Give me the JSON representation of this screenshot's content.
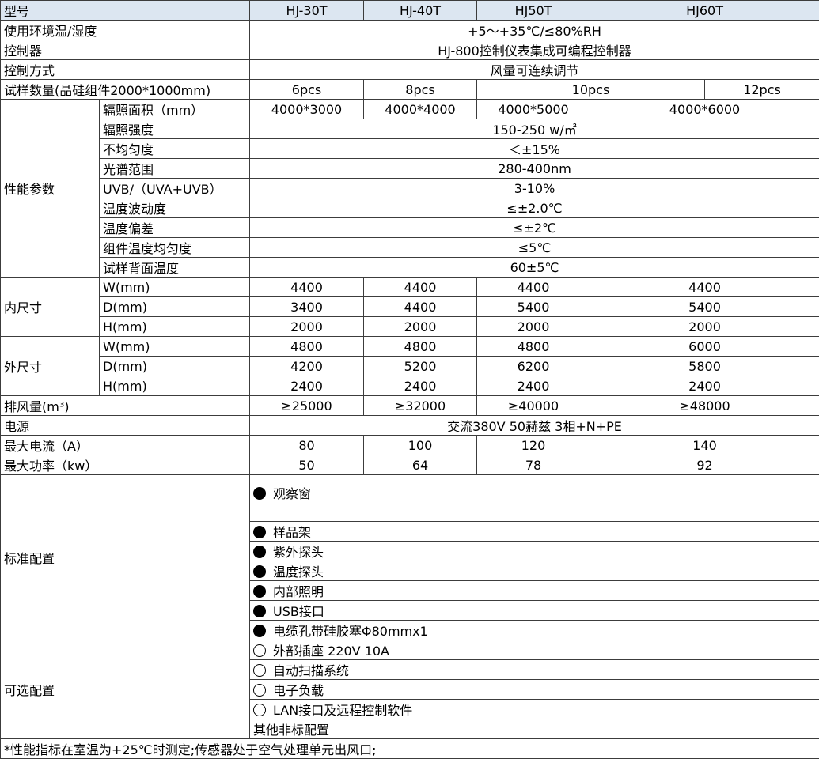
{
  "header": {
    "model": "型号",
    "m1": "HJ-30T",
    "m2": "HJ-40T",
    "m3": "HJ50T",
    "m4": "HJ60T"
  },
  "env": {
    "label": "使用环境温/湿度",
    "value": "+5～+35℃/≤80%RH"
  },
  "controller": {
    "label": "控制器",
    "value": "HJ-800控制仪表集成可编程控制器"
  },
  "control_mode": {
    "label": "控制方式",
    "value": "风量可连续调节"
  },
  "samples": {
    "label": "试样数量(晶硅组件2000*1000mm)",
    "v1": "6pcs",
    "v2": "8pcs",
    "v3": "10pcs",
    "v4": "12pcs"
  },
  "performance": {
    "group": "性能参数",
    "area": {
      "label": "辐照面积（mm）",
      "v1": "4000*3000",
      "v2": "4000*4000",
      "v3": "4000*5000",
      "v4": "4000*6000"
    },
    "intensity": {
      "label": "辐照强度",
      "value": "150-250 w/㎡"
    },
    "nonuniformity": {
      "label": "不均匀度",
      "value": "＜±15%"
    },
    "spectrum": {
      "label": "光谱范围",
      "value": "280-400nm"
    },
    "uvb": {
      "label": "UVB/（UVA+UVB）",
      "value": "3-10%"
    },
    "temp_fluct": {
      "label": "温度波动度",
      "value": "≤±2.0℃"
    },
    "temp_dev": {
      "label": "温度偏差",
      "value": "≤±2℃"
    },
    "temp_uniform": {
      "label": "组件温度均匀度",
      "value": "≤5℃"
    },
    "back_temp": {
      "label": "试样背面温度",
      "value": "60±5℃"
    }
  },
  "inner": {
    "group": "内尺寸",
    "w": {
      "label": "W(mm)",
      "v1": "4400",
      "v2": "4400",
      "v3": "4400",
      "v4": "4400"
    },
    "d": {
      "label": "D(mm)",
      "v1": "3400",
      "v2": "4400",
      "v3": "5400",
      "v4": "5400"
    },
    "h": {
      "label": "H(mm)",
      "v1": "2000",
      "v2": "2000",
      "v3": "2000",
      "v4": "2000"
    }
  },
  "outer": {
    "group": "外尺寸",
    "w": {
      "label": "W(mm)",
      "v1": "4800",
      "v2": "4800",
      "v3": "4800",
      "v4": "6000"
    },
    "d": {
      "label": "D(mm)",
      "v1": "4200",
      "v2": "5200",
      "v3": "6200",
      "v4": "5800"
    },
    "h": {
      "label": "H(mm)",
      "v1": "2400",
      "v2": "2400",
      "v3": "2400",
      "v4": "2400"
    }
  },
  "exhaust": {
    "label": "排风量(m³)",
    "v1": "≥25000",
    "v2": "≥32000",
    "v3": "≥40000",
    "v4": "≥48000"
  },
  "power": {
    "label": "电源",
    "value": "交流380V 50赫兹 3相+N+PE"
  },
  "current": {
    "label": "最大电流（A）",
    "v1": "80",
    "v2": "100",
    "v3": "120",
    "v4": "140"
  },
  "wattage": {
    "label": "最大功率（kw）",
    "v1": "50",
    "v2": "64",
    "v3": "78",
    "v4": "92"
  },
  "standard": {
    "group": "标准配置",
    "items": [
      "观察窗",
      "样品架",
      "紫外探头",
      "温度探头",
      "内部照明",
      "USB接口",
      "电缆孔带硅胶塞Φ80mmx1"
    ]
  },
  "optional": {
    "group": "可选配置",
    "items": [
      "外部插座 220V 10A",
      "自动扫描系统",
      "电子负载",
      "LAN接口及远程控制软件"
    ],
    "other": "其他非标配置"
  },
  "footnote": "*性能指标在室温为+25℃时测定;传感器处于空气处理单元出风口;"
}
